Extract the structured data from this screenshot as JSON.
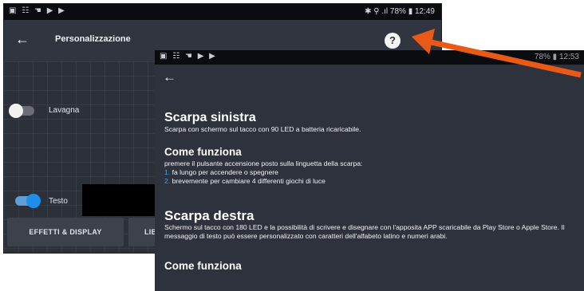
{
  "back_screen": {
    "status_bar": {
      "right_text": "✱ ⚲ .ıl 78% ▮ 12:49"
    },
    "app_bar": {
      "title": "Personalizzazione",
      "help_symbol": "?"
    },
    "toggle_lavagna": {
      "label": "Lavagna",
      "state": "off"
    },
    "toggle_testo": {
      "label": "Testo",
      "state": "on"
    },
    "tabs": [
      "EFFETTI & DISPLAY",
      "LIB"
    ]
  },
  "front_screen": {
    "status_bar": {
      "right_text": "78% ▮ 12:53"
    },
    "sections": {
      "left_title": "Scarpa sinistra",
      "left_desc": "Scarpa con schermo sul tacco con 90 LED a batteria ricaricabile.",
      "how_title": "Come funziona",
      "how_desc": "premere il pulsante  accensione posto sulla linguetta della scarpa:",
      "how_steps": [
        {
          "num": "1.",
          "text": "fa lungo per accendere o spegnere"
        },
        {
          "num": "2.",
          "text": "brevemente per cambiare 4 differenti giochi di luce"
        }
      ],
      "right_title": "Scarpa destra",
      "right_desc": "Schermo sul tacco con 180 LED e la possibilità di scrivere e disegnare con l'apposita APP scaricabile da Play Store o Apple Store. Il messaggio di testo può essere personalizzato con caratteri dell'alfabeto latino e numeri arabi.",
      "how_title_2": "Come funziona"
    }
  },
  "colors": {
    "arrow": "#ea5a17",
    "toggle_on": "#1e8fe8",
    "list_number": "#4aa3ee",
    "background_dark": "#2e323c"
  }
}
